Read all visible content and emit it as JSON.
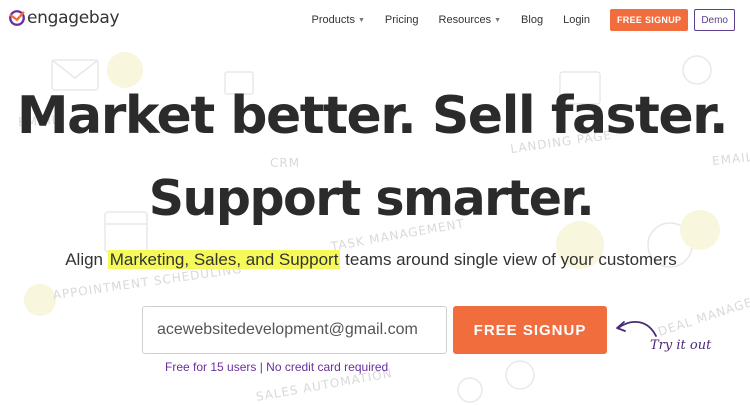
{
  "brand": {
    "name": "engagebay",
    "accent": "#f26d3d",
    "purple": "#5f3f8f"
  },
  "nav": {
    "items": [
      {
        "label": "Products",
        "has_caret": true
      },
      {
        "label": "Pricing",
        "has_caret": false
      },
      {
        "label": "Resources",
        "has_caret": true
      },
      {
        "label": "Blog",
        "has_caret": false
      },
      {
        "label": "Login",
        "has_caret": false
      }
    ],
    "signup_label": "FREE SIGNUP",
    "demo_label": "Demo"
  },
  "hero": {
    "headline_line1": "Market better. Sell faster.",
    "headline_line2": "Support smarter.",
    "sub_before": "Align ",
    "sub_highlight": "Marketing, Sales, and Support",
    "sub_after": " teams around single view of your customers",
    "email_value": "acewebsitedevelopment@gmail.com",
    "signup_label": "FREE SIGNUP",
    "note": "Free for 15 users | No credit card required",
    "try_label": "Try it out"
  },
  "background_labels": {
    "email": "EMAIL",
    "crm": "CRM",
    "landing_page": "LANDING PAGE",
    "task_management": "TASK MANAGEMENT",
    "appointment": "APPOINTMENT SCHEDULING",
    "deal_management": "DEAL MANAGEMENT",
    "sales_automation": "SALES AUTOMATION",
    "email_right": "EMAIL"
  },
  "icons": {
    "logo": "engagebay-logo-icon",
    "caret": "chevron-down-icon",
    "arrow": "curved-arrow-icon"
  }
}
